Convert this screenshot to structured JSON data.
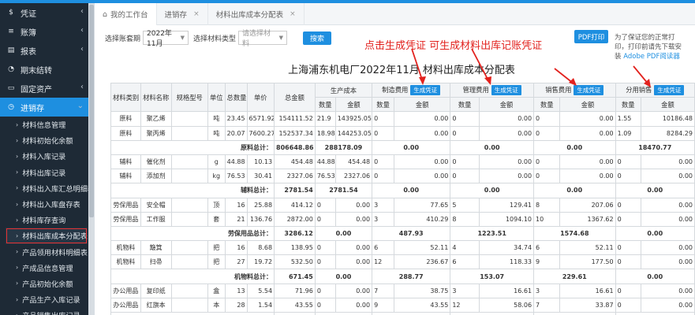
{
  "sidebar": {
    "menu": [
      {
        "icon": "$",
        "label": "凭证",
        "chevron": "‹"
      },
      {
        "icon": "≡",
        "label": "账簿",
        "chevron": "‹"
      },
      {
        "icon": "▤",
        "label": "报表",
        "chevron": "‹"
      },
      {
        "icon": "◔",
        "label": "期末结转",
        "chevron": ""
      },
      {
        "icon": "▭",
        "label": "固定资产",
        "chevron": "‹"
      },
      {
        "icon": "◷",
        "label": "进销存",
        "chevron": "⌄"
      }
    ],
    "submenu": [
      "材料信息管理",
      "材料初始化余额",
      "材料入库记录",
      "材料出库记录",
      "材料出入库汇总明细表",
      "材料出入库盘存表",
      "材料库存查询",
      "材料出库成本分配表",
      "产品领用材料明细表",
      "产成品信息管理",
      "产品初始化余额",
      "产品生产入库记录",
      "产品销售出库记录"
    ],
    "active_sub": "材料出库成本分配表"
  },
  "tabs": [
    {
      "label": "我的工作台",
      "icon": "⌂",
      "close": ""
    },
    {
      "label": "进销存",
      "icon": "",
      "close": "×"
    },
    {
      "label": "材料出库成本分配表",
      "icon": "",
      "close": "×"
    }
  ],
  "toolbar": {
    "period_label": "选择账套期",
    "period_value": "2022年11月",
    "type_label": "选择材料类型",
    "type_placeholder": "请选择材料",
    "query_btn": "搜索",
    "pdf_btn": "PDF打印",
    "pdf_note": "为了保证您的正常打印，打印前请先下载安装",
    "pdf_link": "Adobe PDF阅读器"
  },
  "annotation": "点击生成凭证  可生成材料出库记账凭证",
  "report_title": "上海浦东机电厂2022年11月 材料出库成本分配表",
  "table": {
    "h1": [
      "材料类别",
      "材料名称",
      "规格型号",
      "单位",
      "总数量",
      "单价",
      "总金额",
      "生产成本",
      "制造费用",
      "管理费用",
      "销售费用",
      "分用销售"
    ],
    "gen_btn": "生成凭证",
    "h2": [
      "数量",
      "金额",
      "数量",
      "金额",
      "数量",
      "金额",
      "数量",
      "金额",
      "数量",
      "金额"
    ],
    "rows": [
      {
        "t": "d",
        "c": [
          "原料",
          "聚乙烯",
          "",
          "吨",
          "23.45",
          "6571.92",
          "154111.52",
          "21.9",
          "143925.05",
          "0",
          "0.00",
          "0",
          "0.00",
          "0",
          "0.00",
          "1.55",
          "10186.48"
        ]
      },
      {
        "t": "d",
        "c": [
          "原料",
          "聚丙烯",
          "",
          "吨",
          "20.07",
          "7600.27",
          "152537.34",
          "18.98",
          "144253.05",
          "0",
          "0.00",
          "0",
          "0.00",
          "0",
          "0.00",
          "1.09",
          "8284.29"
        ]
      },
      {
        "t": "s",
        "label": "原料总计：",
        "v": [
          "806648.86",
          "288178.09",
          "0.00",
          "0.00",
          "0.00",
          "18470.77"
        ]
      },
      {
        "t": "d",
        "c": [
          "辅料",
          "催化剂",
          "",
          "g",
          "44.88",
          "10.13",
          "454.48",
          "44.88",
          "454.48",
          "0",
          "0.00",
          "0",
          "0.00",
          "0",
          "0.00",
          "0",
          "0.00"
        ]
      },
      {
        "t": "d",
        "c": [
          "辅料",
          "添加剂",
          "",
          "kg",
          "76.53",
          "30.41",
          "2327.06",
          "76.53",
          "2327.06",
          "0",
          "0.00",
          "0",
          "0.00",
          "0",
          "0.00",
          "0",
          "0.00"
        ]
      },
      {
        "t": "s",
        "label": "辅料总计：",
        "v": [
          "2781.54",
          "2781.54",
          "0.00",
          "0.00",
          "0.00",
          "0.00"
        ]
      },
      {
        "t": "d",
        "c": [
          "劳保用品",
          "安全帽",
          "",
          "顶",
          "16",
          "25.88",
          "414.12",
          "0",
          "0.00",
          "3",
          "77.65",
          "5",
          "129.41",
          "8",
          "207.06",
          "0",
          "0.00"
        ]
      },
      {
        "t": "d",
        "c": [
          "劳保用品",
          "工作服",
          "",
          "套",
          "21",
          "136.76",
          "2872.00",
          "0",
          "0.00",
          "3",
          "410.29",
          "8",
          "1094.10",
          "10",
          "1367.62",
          "0",
          "0.00"
        ]
      },
      {
        "t": "s",
        "label": "劳保用品总计：",
        "v": [
          "3286.12",
          "0.00",
          "487.93",
          "1223.51",
          "1574.68",
          "0.00"
        ]
      },
      {
        "t": "d",
        "c": [
          "机物料",
          "簸箕",
          "",
          "把",
          "16",
          "8.68",
          "138.95",
          "0",
          "0.00",
          "6",
          "52.11",
          "4",
          "34.74",
          "6",
          "52.11",
          "0",
          "0.00"
        ]
      },
      {
        "t": "d",
        "c": [
          "机物料",
          "扫帚",
          "",
          "把",
          "27",
          "19.72",
          "532.50",
          "0",
          "0.00",
          "12",
          "236.67",
          "6",
          "118.33",
          "9",
          "177.50",
          "0",
          "0.00"
        ]
      },
      {
        "t": "s",
        "label": "机物料总计：",
        "v": [
          "671.45",
          "0.00",
          "288.77",
          "153.07",
          "229.61",
          "0.00"
        ]
      },
      {
        "t": "d",
        "c": [
          "办公用品",
          "复印纸",
          "",
          "盒",
          "13",
          "5.54",
          "71.96",
          "0",
          "0.00",
          "7",
          "38.75",
          "3",
          "16.61",
          "3",
          "16.61",
          "0",
          "0.00"
        ]
      },
      {
        "t": "d",
        "c": [
          "办公用品",
          "红旗本",
          "",
          "本",
          "28",
          "1.54",
          "43.55",
          "0",
          "0.00",
          "9",
          "43.55",
          "12",
          "58.06",
          "7",
          "33.87",
          "0",
          "0.00"
        ]
      },
      {
        "t": "s",
        "label": "办公用品总计：",
        "v": [
          "207.45",
          "0.00",
          "82.30",
          "74.67",
          "50.48",
          "0.00"
        ]
      }
    ]
  },
  "colors": {
    "accent": "#1e8fe0",
    "sidebar": "#1e2a36",
    "annotation": "#e2221e"
  }
}
